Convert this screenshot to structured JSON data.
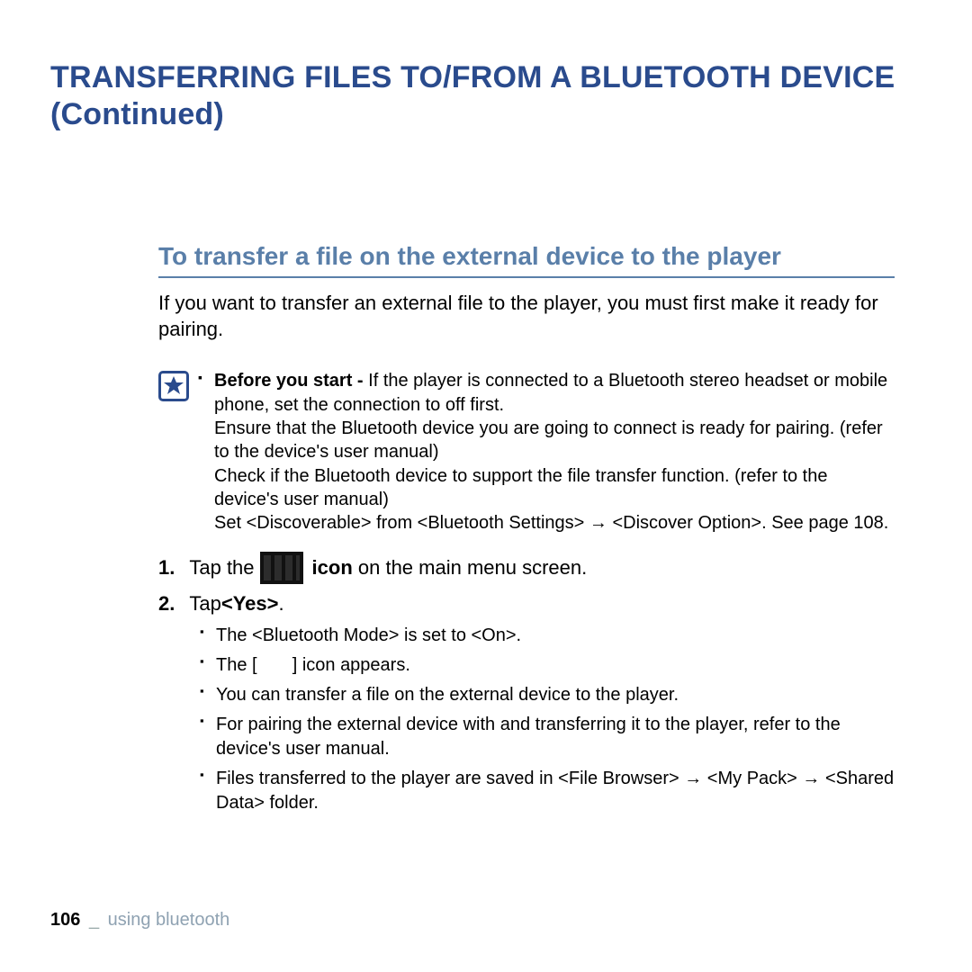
{
  "title": "TRANSFERRING FILES TO/FROM A BLUETOOTH DEVICE (Continued)",
  "subtitle": "To transfer a file on the external device to the player",
  "intro": "If you want to transfer an external file to the player, you must first make it ready for pairing.",
  "note": {
    "before_label": "Before you start - ",
    "l1": "If the player is connected to a Bluetooth stereo headset or mobile phone, set the connection to off first.",
    "l2": "Ensure that the Bluetooth device you are going to connect is ready for pairing. (refer to the device's user manual)",
    "l3": "Check if the Bluetooth device to support the file transfer function. (refer to the device's user manual)",
    "l4": "Set <Discoverable> from <Bluetooth Settings> → <Discover Option>. See page 108."
  },
  "step1": {
    "num": "1.",
    "pre": "Tap the ",
    "bold": "icon",
    "post": " on the main menu screen."
  },
  "step2": {
    "num": "2.",
    "pre": "Tap ",
    "bold": "<Yes>",
    "post": "."
  },
  "subs": {
    "s1": "The <Bluetooth Mode> is set to <On>.",
    "s2a": "The [",
    "s2b": "] icon appears.",
    "s3": "You can transfer a file on the external device to the player.",
    "s4": "For pairing the external device with and transferring it to the player, refer to the device's user manual.",
    "s5": "Files transferred to the player are saved in <File Browser> → <My Pack> → <Shared Data> folder."
  },
  "footer": {
    "page_number": "106",
    "separator": "_",
    "section": "using bluetooth"
  }
}
